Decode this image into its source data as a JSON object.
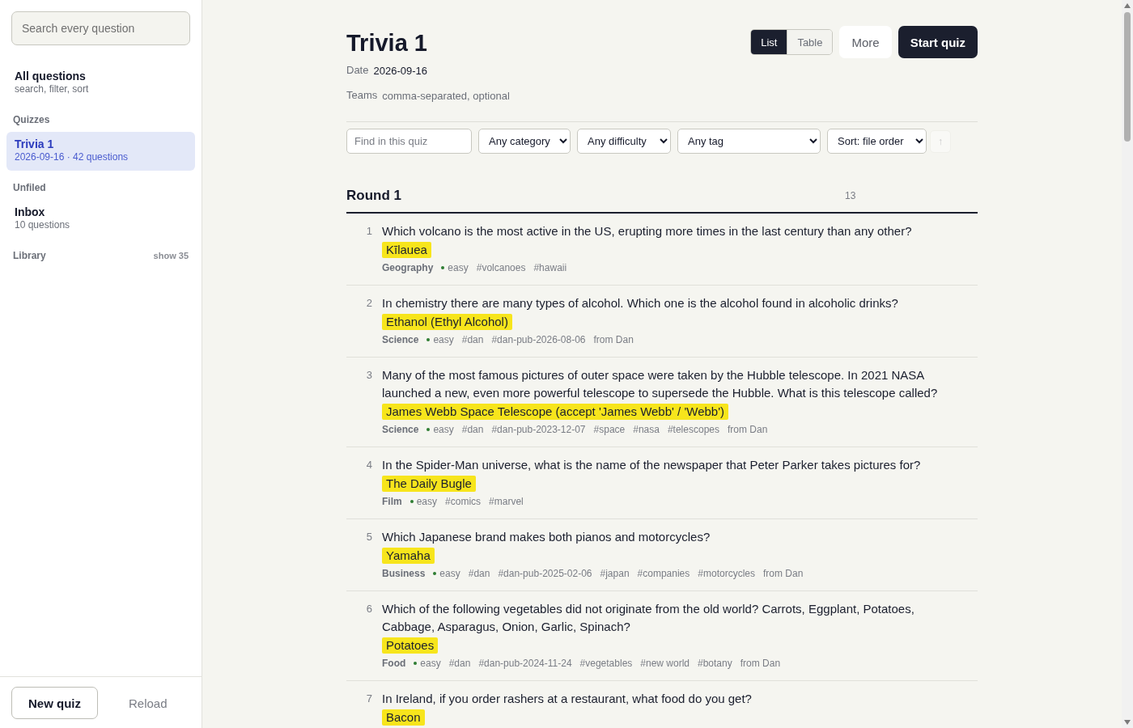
{
  "sidebar": {
    "search": {
      "placeholder": "Search every question"
    },
    "all_questions": {
      "title": "All questions",
      "subtitle": "search, filter, sort",
      "selected": false
    },
    "sections": [
      {
        "label": "Quizzes",
        "items": [
          {
            "title": "Trivia 1",
            "subtitle": "2026-09-16 · 42 questions",
            "selected": true
          }
        ]
      },
      {
        "label": "Unfiled",
        "items": [
          {
            "title": "Inbox",
            "subtitle": "10 questions",
            "selected": false
          }
        ]
      },
      {
        "label": "Library",
        "action": "show 35"
      }
    ],
    "new_quiz_button": "New quiz",
    "reload_button": "Reload"
  },
  "header": {
    "title": "Trivia 1",
    "view_toggle": [
      {
        "label": "List",
        "selected": true
      },
      {
        "label": "Table",
        "selected": false
      }
    ],
    "more_button": "More",
    "start_button": "Start quiz",
    "date": {
      "label": "Date",
      "value": "2026-09-16"
    },
    "teams": {
      "label": "Teams",
      "placeholder": "comma-separated, optional"
    }
  },
  "filters": {
    "search": {
      "placeholder": "Find in this quiz"
    },
    "dropdowns": [
      {
        "value": "Any category"
      },
      {
        "value": "Any difficulty"
      },
      {
        "value": "Any tag"
      },
      {
        "value": "Sort: file order"
      }
    ],
    "sort_direction": {
      "label": "↑",
      "disabled": true
    }
  },
  "round": {
    "title": "Round 1",
    "count": "13",
    "questions": [
      {
        "number": "1",
        "question": "Which volcano is the most active in the US, erupting more times in the last century than any other?",
        "answer": "Kīlauea",
        "category": "Geography",
        "difficulty": "easy",
        "tags": [
          "#volcanoes",
          "#hawaii"
        ]
      },
      {
        "number": "2",
        "question": "In chemistry there are many types of alcohol. Which one is the alcohol found in alcoholic drinks?",
        "answer": "Ethanol (Ethyl Alcohol)",
        "category": "Science",
        "difficulty": "easy",
        "tags": [
          "#dan",
          "#dan-pub-2026-08-06"
        ],
        "source": "from Dan"
      },
      {
        "number": "3",
        "question": "Many of the most famous pictures of outer space were taken by the Hubble telescope. In 2021 NASA launched a new, even more powerful telescope to supersede the Hubble. What is this telescope called?",
        "answer": "James Webb Space Telescope (accept 'James Webb' / 'Webb')",
        "category": "Science",
        "difficulty": "easy",
        "tags": [
          "#dan",
          "#dan-pub-2023-12-07",
          "#space",
          "#nasa",
          "#telescopes"
        ],
        "source": "from Dan"
      },
      {
        "number": "4",
        "question": "In the Spider-Man universe, what is the name of the newspaper that Peter Parker takes pictures for?",
        "answer": "The Daily Bugle",
        "category": "Film",
        "difficulty": "easy",
        "tags": [
          "#comics",
          "#marvel"
        ]
      },
      {
        "number": "5",
        "question": "Which Japanese brand makes both pianos and motorcycles?",
        "answer": "Yamaha",
        "category": "Business",
        "difficulty": "easy",
        "tags": [
          "#dan",
          "#dan-pub-2025-02-06",
          "#japan",
          "#companies",
          "#motorcycles"
        ],
        "source": "from Dan"
      },
      {
        "number": "6",
        "question": "Which of the following vegetables did not originate from the old world? Carrots, Eggplant, Potatoes, Cabbage, Asparagus, Onion, Garlic, Spinach?",
        "answer": "Potatoes",
        "category": "Food",
        "difficulty": "easy",
        "tags": [
          "#dan",
          "#dan-pub-2024-11-24",
          "#vegetables",
          "#new world",
          "#botany"
        ],
        "source": "from Dan"
      },
      {
        "number": "7",
        "question": "In Ireland, if you order rashers at a restaurant, what food do you get?",
        "answer": "Bacon"
      }
    ]
  }
}
